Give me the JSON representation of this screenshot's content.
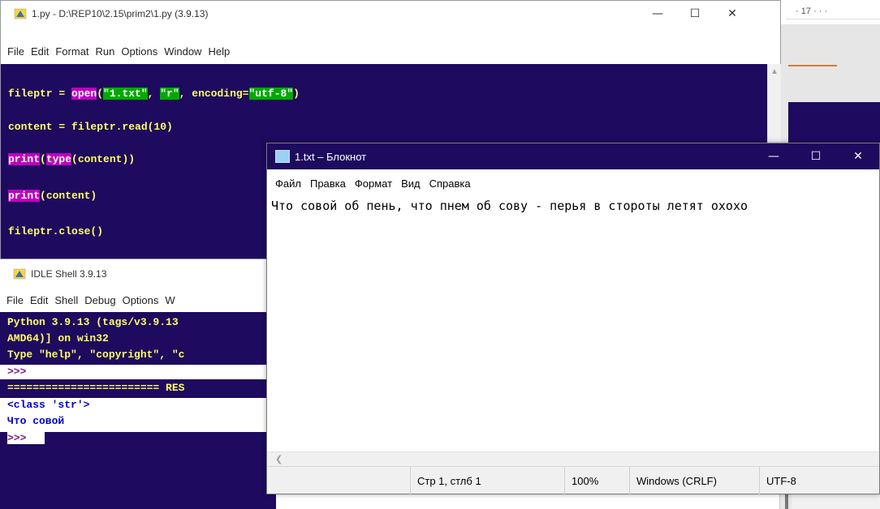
{
  "background_window": {
    "ruler_text": "· 17 · · ·"
  },
  "editor": {
    "title": "1.py - D:\\REP10\\2.15\\prim2\\1.py (3.9.13)",
    "controls": {
      "minimize": "—",
      "maximize": "☐",
      "close": "✕"
    },
    "menu": [
      "File",
      "Edit",
      "Format",
      "Run",
      "Options",
      "Window",
      "Help"
    ],
    "code_lines": {
      "line1": {
        "a": "fileptr = ",
        "b": "open",
        "c": "(",
        "d": "\"1.txt\"",
        "e": ", ",
        "f": "\"r\"",
        "g": ", encoding=",
        "h": "\"utf-8\"",
        "i": ")"
      },
      "line2": "content = fileptr.read(10)",
      "line3": {
        "a": "print",
        "b": "(",
        "c": "type",
        "d": "(content))"
      },
      "line4": {
        "a": "print",
        "b": "(content)"
      },
      "line5": "fileptr.close()"
    },
    "colors": {
      "background": "#1e0a5e",
      "text": "#ffff66",
      "keyword_bg": "#c000c0",
      "string_bg": "#00aa00"
    }
  },
  "shell": {
    "title": "IDLE Shell 3.9.13",
    "menu": [
      "File",
      "Edit",
      "Shell",
      "Debug",
      "Options",
      "W"
    ],
    "lines": {
      "l1": "Python 3.9.13 (tags/v3.9.13",
      "l2": "AMD64)] on win32",
      "l3": "Type \"help\", \"copyright\", \"c",
      "l4": ">>>",
      "l5": "======================== RES",
      "l6": "<class 'str'>",
      "l7": "Что совой",
      "l8": ">>>"
    }
  },
  "notepad": {
    "title": "1.txt – Блокнот",
    "controls": {
      "minimize": "—",
      "maximize": "☐",
      "close": "✕"
    },
    "menu": [
      "Файл",
      "Правка",
      "Формат",
      "Вид",
      "Справка"
    ],
    "content": "Что совой об пень, что пнем об сову - перья в стороты летят охохо",
    "status": {
      "position": "Стр 1, стлб 1",
      "zoom": "100%",
      "line_endings": "Windows (CRLF)",
      "encoding": "UTF-8"
    }
  }
}
